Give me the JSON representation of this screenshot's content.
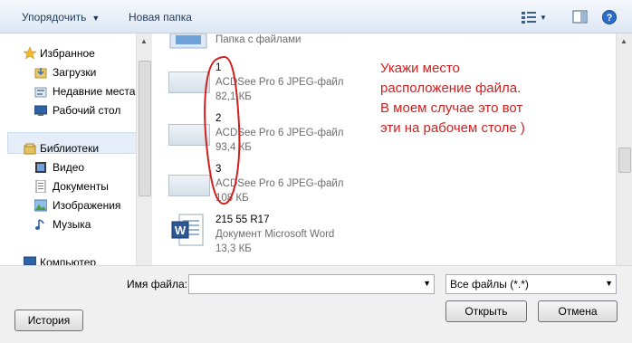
{
  "toolbar": {
    "organize_label": "Упорядочить",
    "new_folder_label": "Новая папка",
    "view_icon": "view-icon",
    "preview_icon": "preview-pane-icon",
    "help_icon": "help-icon"
  },
  "nav": {
    "items": [
      {
        "label": "Избранное",
        "icon": "star-icon"
      },
      {
        "label": "Загрузки",
        "icon": "downloads-icon"
      },
      {
        "label": "Недавние места",
        "icon": "recent-places-icon"
      },
      {
        "label": "Рабочий стол",
        "icon": "desktop-icon"
      },
      {
        "label": "Библиотеки",
        "icon": "libraries-icon"
      },
      {
        "label": "Видео",
        "icon": "video-icon"
      },
      {
        "label": "Документы",
        "icon": "documents-icon"
      },
      {
        "label": "Изображения",
        "icon": "pictures-icon"
      },
      {
        "label": "Музыка",
        "icon": "music-icon"
      },
      {
        "label": "Компьютер",
        "icon": "computer-icon"
      }
    ]
  },
  "files": [
    {
      "name": "Папка с файлами",
      "type": "",
      "size": "",
      "icon": "folder-icon"
    },
    {
      "name": "1",
      "type": "ACDSee Pro 6 JPEG-файл",
      "size": "82,1 КБ",
      "icon": "jpeg-thumbnail"
    },
    {
      "name": "2",
      "type": "ACDSee Pro 6 JPEG-файл",
      "size": "93,4 КБ",
      "icon": "jpeg-thumbnail"
    },
    {
      "name": "3",
      "type": "ACDSee Pro 6 JPEG-файл",
      "size": "108 КБ",
      "icon": "jpeg-thumbnail"
    },
    {
      "name": "215 55 R17",
      "type": "Документ Microsoft Word",
      "size": "13,3 КБ",
      "icon": "word-document-icon"
    }
  ],
  "annotation": {
    "line1": "Укажи место",
    "line2": "расположение файла.",
    "line3": "В моем случае это вот",
    "line4": "эти на рабочем столе )",
    "color": "#d12020"
  },
  "footer": {
    "filename_label": "Имя файла:",
    "filename_value": "",
    "filter_value": "Все файлы (*.*)",
    "history_button": "История",
    "open_button": "Открыть",
    "cancel_button": "Отмена"
  }
}
